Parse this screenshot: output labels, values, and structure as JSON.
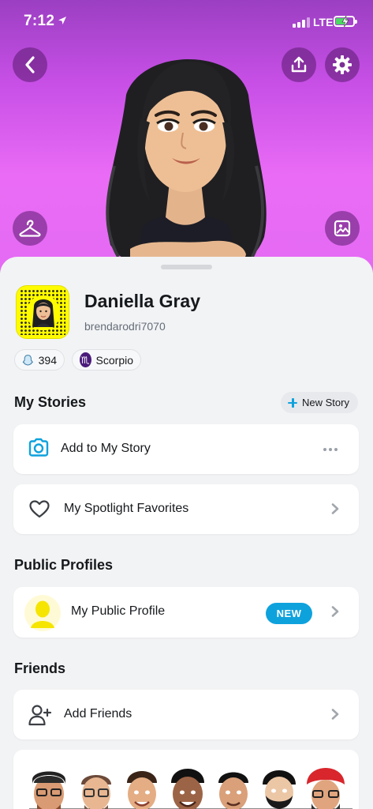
{
  "status_bar": {
    "time": "7:12",
    "network": "LTE"
  },
  "profile": {
    "display_name": "Daniella Gray",
    "username": "brendarodri7070",
    "snap_score": "394",
    "zodiac": "Scorpio",
    "zodiac_symbol": "♏"
  },
  "my_stories": {
    "title": "My Stories",
    "new_story_label": "New Story",
    "items": [
      {
        "label": "Add to My Story",
        "icon": "camera-icon"
      },
      {
        "label": "My Spotlight Favorites",
        "icon": "heart-icon"
      }
    ]
  },
  "public_profiles": {
    "title": "Public Profiles",
    "item_label": "My Public Profile",
    "badge": "NEW"
  },
  "friends": {
    "title": "Friends",
    "add_label": "Add Friends"
  },
  "colors": {
    "accent": "#0ea2dd",
    "snap_yellow": "#fffc00",
    "header_gradient_top": "#9b3fc2",
    "header_gradient_bottom": "#e46af3"
  },
  "icons": {
    "header": [
      "back-arrow-icon",
      "share-icon",
      "gear-icon",
      "hanger-icon",
      "photo-icon"
    ]
  }
}
